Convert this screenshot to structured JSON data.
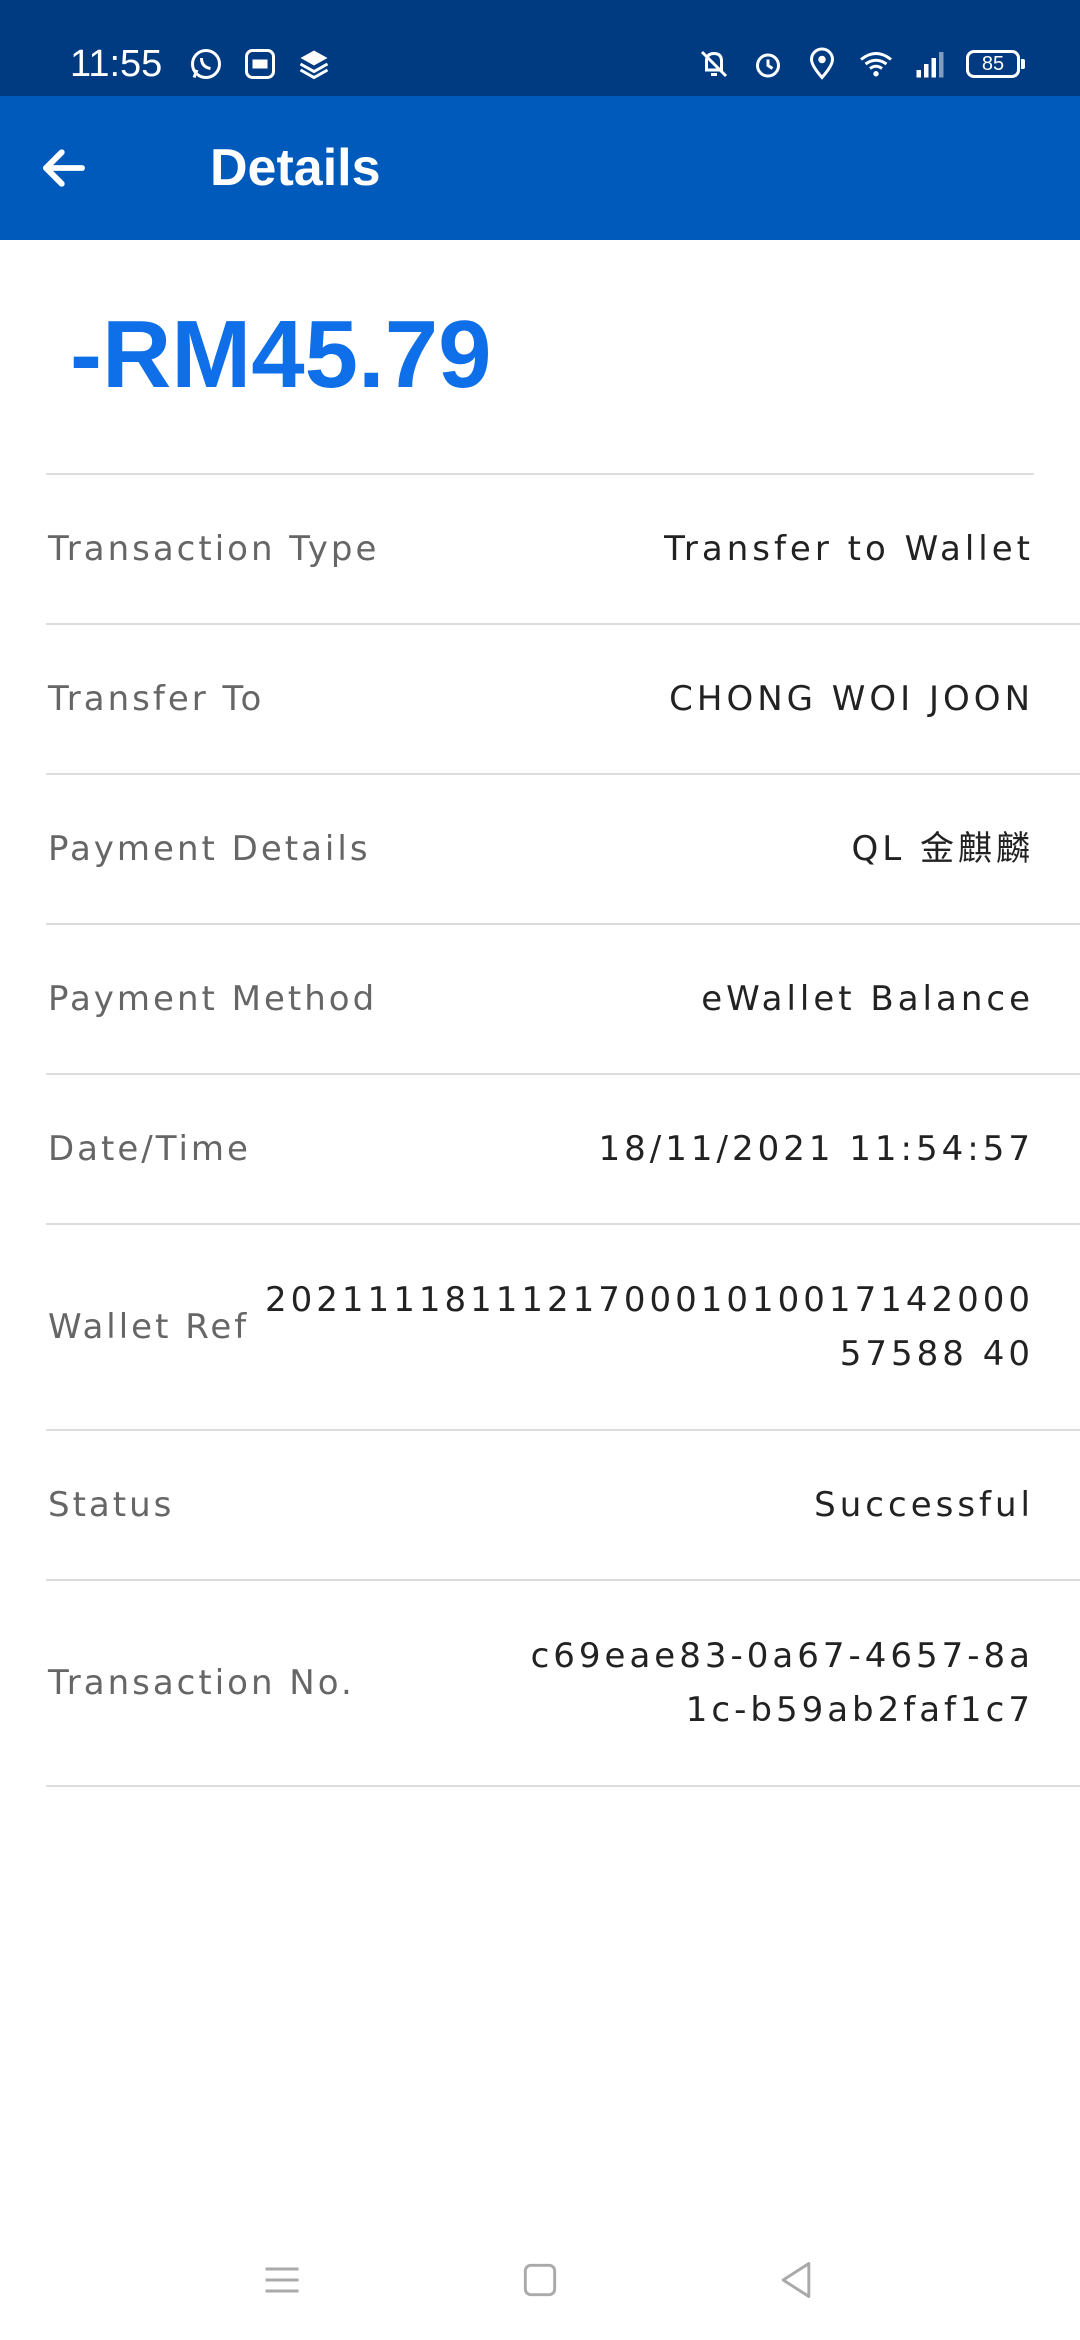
{
  "status_bar": {
    "time": "11:55",
    "battery": "85",
    "left_icons": [
      "whatsapp-icon",
      "tng-ewallet-icon",
      "layers-icon"
    ],
    "right_icons": [
      "vibrate-off-icon",
      "alarm-icon",
      "location-icon",
      "wifi-icon",
      "signal-icon",
      "battery-icon"
    ]
  },
  "app_bar": {
    "title": "Details",
    "back_icon": "arrow-left-icon"
  },
  "amount": "-RM45.79",
  "details": {
    "transaction_type": {
      "label": "Transaction Type",
      "value": "Transfer to Wallet"
    },
    "transfer_to": {
      "label": "Transfer To",
      "value": "CHONG WOI JOON"
    },
    "payment_details": {
      "label": "Payment Details",
      "value": "QL 金麒麟"
    },
    "payment_method": {
      "label": "Payment Method",
      "value": "eWallet Balance"
    },
    "date_time": {
      "label": "Date/Time",
      "value": "18/11/2021 11:54:57"
    },
    "wallet_ref": {
      "label": "Wallet Ref",
      "value": "20211118111217000101001714200057588 40"
    },
    "status": {
      "label": "Status",
      "value": "Successful"
    },
    "transaction_no": {
      "label": "Transaction No.",
      "value": "c69eae83-0a67-4657-8a1c-b59ab2faf1c7"
    }
  },
  "nav_bar": {
    "menu_icon": "menu-icon",
    "home_icon": "home-square-icon",
    "back_icon": "back-triangle-icon"
  },
  "colors": {
    "status_bar": "#003a80",
    "app_bar": "#005abb",
    "amount": "#0f6fe8"
  }
}
